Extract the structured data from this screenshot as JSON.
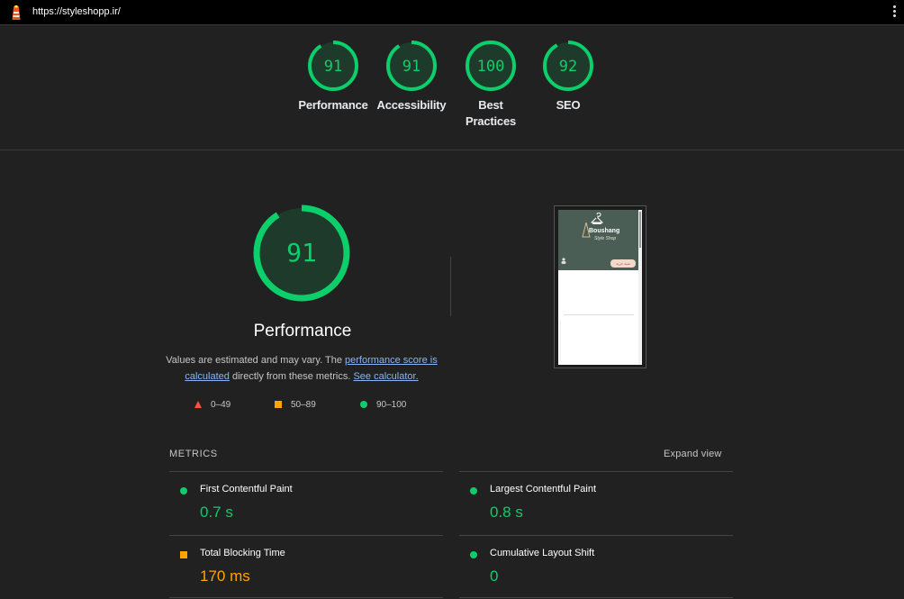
{
  "url_bar": {
    "url": "https://styleshopp.ir/"
  },
  "categories": [
    {
      "score": "91",
      "label": "Performance"
    },
    {
      "score": "91",
      "label": "Accessibility"
    },
    {
      "score": "100",
      "label": "Best Practices"
    },
    {
      "score": "92",
      "label": "SEO"
    }
  ],
  "performance": {
    "score": "91",
    "title": "Performance",
    "desc_1": "Values are estimated and may vary. The ",
    "desc_link_1": "performance score is calculated",
    "desc_2": " directly from these metrics. ",
    "desc_link_2": "See calculator."
  },
  "legend": {
    "fail": "0–49",
    "average": "50–89",
    "pass": "90–100"
  },
  "screenshot": {
    "brand": "Boushang",
    "script": "Style Shop",
    "button": "سبد خرید"
  },
  "metrics": {
    "heading": "METRICS",
    "expand_label": "Expand view",
    "items": [
      {
        "name": "First Contentful Paint",
        "value": "0.7 s",
        "rating": "pass"
      },
      {
        "name": "Largest Contentful Paint",
        "value": "0.8 s",
        "rating": "pass"
      },
      {
        "name": "Total Blocking Time",
        "value": "170 ms",
        "rating": "average"
      },
      {
        "name": "Cumulative Layout Shift",
        "value": "0",
        "rating": "pass"
      }
    ]
  },
  "colors": {
    "pass": "#0cce6b",
    "average": "#ffa400",
    "fail": "#ff4e42",
    "link": "#8ab4f8",
    "background": "#212121"
  }
}
